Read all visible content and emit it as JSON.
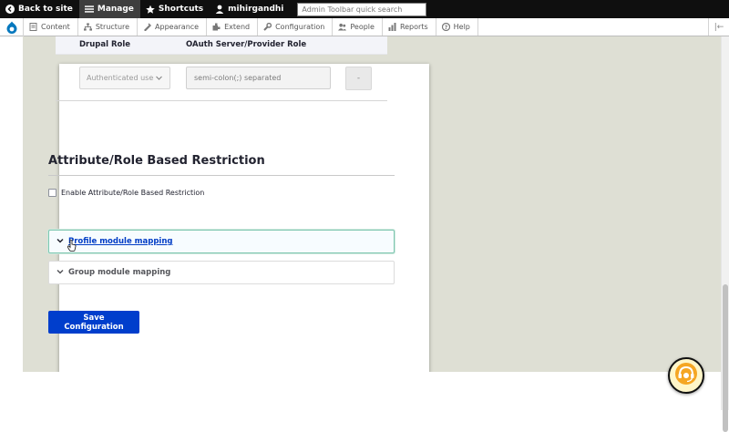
{
  "toolbar": {
    "back_to_site": "Back to site",
    "manage": "Manage",
    "shortcuts": "Shortcuts",
    "user": "mihirgandhi",
    "search_placeholder": "Admin Toolbar quick search"
  },
  "tray": {
    "items": [
      {
        "label": "Content",
        "icon": "content-icon"
      },
      {
        "label": "Structure",
        "icon": "structure-icon"
      },
      {
        "label": "Appearance",
        "icon": "appearance-icon"
      },
      {
        "label": "Extend",
        "icon": "extend-icon"
      },
      {
        "label": "Configuration",
        "icon": "wrench-icon"
      },
      {
        "label": "People",
        "icon": "people-icon"
      },
      {
        "label": "Reports",
        "icon": "reports-icon"
      },
      {
        "label": "Help",
        "icon": "help-icon"
      }
    ],
    "orientation_toggle": "|←"
  },
  "role_mapping": {
    "headers": [
      "Drupal Role",
      "OAuth Server/Provider Role"
    ],
    "row": {
      "drupal_role_value": "Authenticated user",
      "provider_role_placeholder": "semi-colon(;) separated",
      "remove_label": "-"
    }
  },
  "restriction": {
    "title": "Attribute/Role Based Restriction",
    "checkbox_label": "Enable Attribute/Role Based Restriction",
    "checkbox_checked": false
  },
  "mappings": [
    {
      "label": "Profile module mapping",
      "focused": true
    },
    {
      "label": "Group module mapping",
      "focused": false
    }
  ],
  "actions": {
    "save_label": "Save Configuration"
  },
  "colors": {
    "toolbar_bg": "#0f0f0f",
    "primary_button": "#003ecc",
    "page_background": "#dedfd4",
    "focus_border": "#7fc7b0",
    "link_blue": "#003cc5"
  }
}
